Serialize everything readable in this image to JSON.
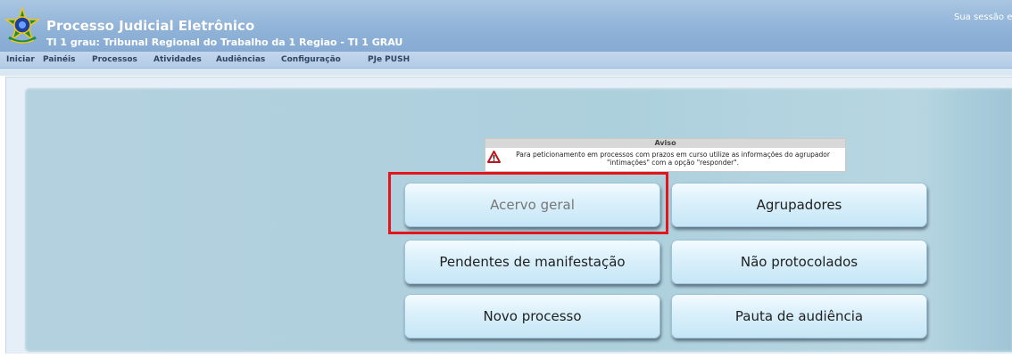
{
  "header": {
    "title": "Processo Judicial Eletrônico",
    "subtitle": "TI 1 grau: Tribunal Regional do Trabalho da 1 Regiao - TI 1 GRAU",
    "session_text": "Sua sessão e"
  },
  "menu": {
    "items": [
      "Iniciar",
      "Painéis",
      "Processos",
      "Atividades",
      "Audiências",
      "Configuração",
      "PJe PUSH"
    ]
  },
  "notice": {
    "title": "Aviso",
    "line1": "Para peticionamento em processos com prazos em curso utilize as informações do agrupador",
    "line2": "\"intimações\" com a opção \"responder\"."
  },
  "buttons": {
    "acervo_geral": "Acervo geral",
    "agrupadores": "Agrupadores",
    "pendentes": "Pendentes de manifestação",
    "nao_protocolados": "Não protocolados",
    "novo_processo": "Novo processo",
    "pauta": "Pauta de audiência"
  },
  "colors": {
    "header_blue": "#90b3d8",
    "highlight_red": "#e3151a",
    "panel_teal": "#add0dd"
  },
  "icons": {
    "logo": "brazil-coat-of-arms-icon",
    "notice": "warning-triangle-icon"
  }
}
